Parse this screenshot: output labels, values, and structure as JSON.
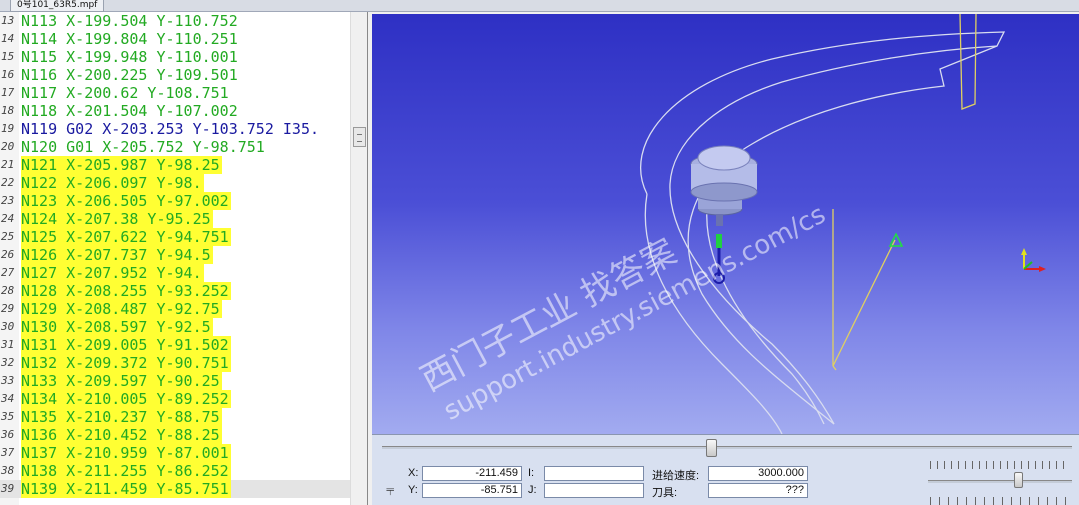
{
  "tab": {
    "title": "0号101_63R5.mpf"
  },
  "editor": {
    "lines": [
      {
        "num": "13",
        "text": "N113 X-199.504 Y-110.752",
        "style": "normal"
      },
      {
        "num": "14",
        "text": "N114 X-199.804 Y-110.251",
        "style": "normal"
      },
      {
        "num": "15",
        "text": "N115 X-199.948 Y-110.001",
        "style": "normal"
      },
      {
        "num": "16",
        "text": "N116 X-200.225 Y-109.501",
        "style": "normal"
      },
      {
        "num": "17",
        "text": "N117 X-200.62 Y-108.751",
        "style": "normal"
      },
      {
        "num": "18",
        "text": "N118 X-201.504 Y-107.002",
        "style": "normal"
      },
      {
        "num": "19",
        "text": "N119 G02 X-203.253 Y-103.752 I35.",
        "style": "blue"
      },
      {
        "num": "20",
        "text": "N120 G01 X-205.752 Y-98.751",
        "style": "normal"
      },
      {
        "num": "21",
        "text": "N121 X-205.987 Y-98.25",
        "style": "highlight"
      },
      {
        "num": "22",
        "text": "N122 X-206.097 Y-98.",
        "style": "highlight"
      },
      {
        "num": "23",
        "text": "N123 X-206.505 Y-97.002",
        "style": "highlight"
      },
      {
        "num": "24",
        "text": "N124 X-207.38 Y-95.25",
        "style": "highlight"
      },
      {
        "num": "25",
        "text": "N125 X-207.622 Y-94.751",
        "style": "highlight"
      },
      {
        "num": "26",
        "text": "N126 X-207.737 Y-94.5",
        "style": "highlight"
      },
      {
        "num": "27",
        "text": "N127 X-207.952 Y-94.",
        "style": "highlight"
      },
      {
        "num": "28",
        "text": "N128 X-208.255 Y-93.252",
        "style": "highlight"
      },
      {
        "num": "29",
        "text": "N129 X-208.487 Y-92.75",
        "style": "highlight"
      },
      {
        "num": "30",
        "text": "N130 X-208.597 Y-92.5",
        "style": "highlight"
      },
      {
        "num": "31",
        "text": "N131 X-209.005 Y-91.502",
        "style": "highlight"
      },
      {
        "num": "32",
        "text": "N132 X-209.372 Y-90.751",
        "style": "highlight"
      },
      {
        "num": "33",
        "text": "N133 X-209.597 Y-90.25",
        "style": "highlight"
      },
      {
        "num": "34",
        "text": "N134 X-210.005 Y-89.252",
        "style": "highlight"
      },
      {
        "num": "35",
        "text": "N135 X-210.237 Y-88.75",
        "style": "highlight"
      },
      {
        "num": "36",
        "text": "N136 X-210.452 Y-88.25",
        "style": "highlight"
      },
      {
        "num": "37",
        "text": "N137 X-210.959 Y-87.001",
        "style": "highlight"
      },
      {
        "num": "38",
        "text": "N138 X-211.255 Y-86.252",
        "style": "highlight"
      },
      {
        "num": "39",
        "text": "N139 X-211.459 Y-85.751",
        "style": "current"
      }
    ]
  },
  "viewport": {
    "watermark_line1": "西门子工业  找答案",
    "watermark_line2": "support.industry.siemens.com/cs"
  },
  "panel": {
    "x_label": "X:",
    "x_value": "-211.459",
    "y_label": "Y:",
    "y_value": "-85.751",
    "i_label": "I:",
    "i_value": "",
    "j_label": "J:",
    "j_value": "",
    "feed_label": "进给速度:",
    "feed_value": "3000.000",
    "tool_label": "刀具:",
    "tool_value": "???",
    "tool_icon": "tool-holder-icon"
  }
}
